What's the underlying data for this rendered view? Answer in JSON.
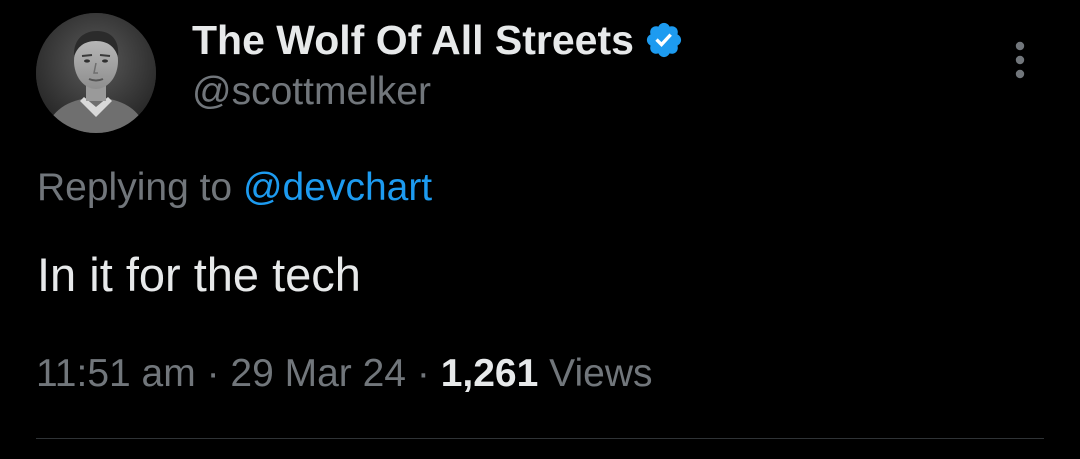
{
  "author": {
    "display_name": "The Wolf Of All Streets",
    "handle": "@scottmelker",
    "verified": true,
    "avatar_icon": "profile-photo"
  },
  "reply_context": {
    "prefix": "Replying to",
    "mention": "@devchart"
  },
  "tweet": {
    "text": "In it for the tech"
  },
  "meta": {
    "time": "11:51 am",
    "separator": "·",
    "date": "29 Mar 24",
    "views_count": "1,261",
    "views_label": "Views"
  },
  "icons": {
    "verified": "verified-badge-icon",
    "more": "more-options-icon"
  },
  "colors": {
    "background": "#000000",
    "primary_text": "#e7e9ea",
    "secondary_text": "#71767b",
    "accent": "#1d9bf0",
    "divider": "#2f3336"
  }
}
